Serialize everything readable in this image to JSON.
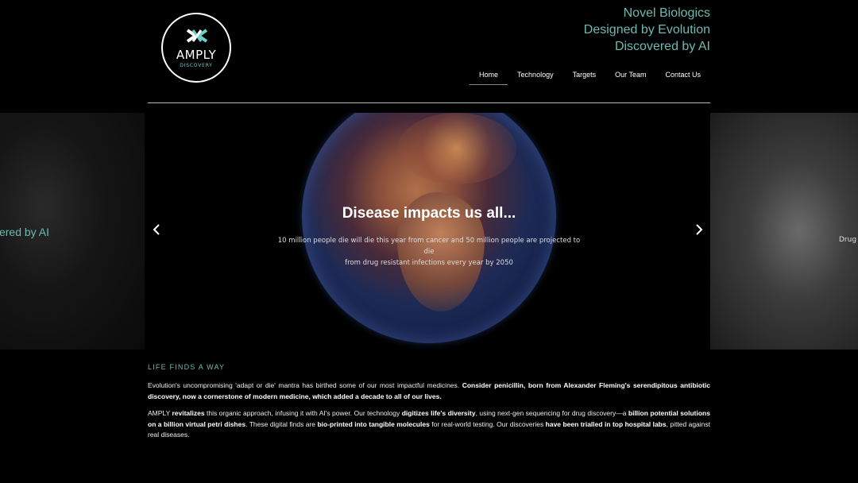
{
  "brand": {
    "name": "AMPLY",
    "sub": "DISCOVERY",
    "accent": "#6fb9b0"
  },
  "tagline": [
    "Novel Biologics",
    "Designed by Evolution",
    "Discovered by AI"
  ],
  "nav": {
    "items": [
      "Home",
      "Technology",
      "Targets",
      "Our Team",
      "Contact Us"
    ],
    "active": "Home"
  },
  "carousel": {
    "prev_ghost_text": "ered by AI",
    "next_ghost_text": "Drug c",
    "title": "Disease impacts us all...",
    "text_line1": "10 million people die will die this year from cancer and 50 million people are projected to die",
    "text_line2": "from drug resistant infections every year by 2050",
    "prev_icon": "chevron-left-icon",
    "next_icon": "chevron-right-icon"
  },
  "intro": {
    "heading": "LIFE FINDS A WAY",
    "p1_a": "Evolution's uncompromising 'adapt or die' mantra has birthed some of our most impactful medicines. ",
    "p1_b": "Consider penicillin, born from Alexander Fleming's serendipitous antibiotic discovery, now a cornerstone of modern medicine, which added a decade to all of our lives.",
    "p2_a": "AMPLY ",
    "p2_b": "revitalizes",
    "p2_c": " this organic approach, infusing it with AI's power. Our technology ",
    "p2_d": "digitizes life's diversity",
    "p2_e": ", using next-gen sequencing for drug discovery—a ",
    "p2_f": "billion potential solutions on a billion virtual petri dishes",
    "p2_g": ". These digital finds are ",
    "p2_h": "bio-printed into tangible molecules",
    "p2_i": " for real-world testing. Our discoveries ",
    "p2_j": "have been trialled in top hospital labs",
    "p2_k": ", pitted against real diseases."
  }
}
